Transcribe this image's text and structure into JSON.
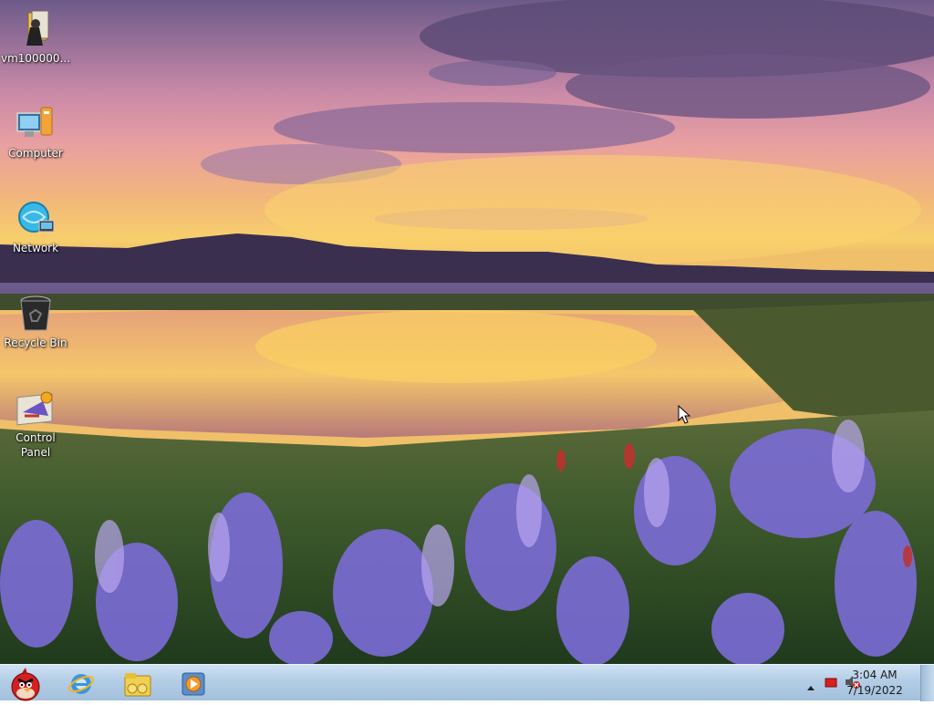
{
  "desktop": {
    "icons": [
      {
        "label": "vm100000...",
        "icon": "file-icon"
      },
      {
        "label": "Computer",
        "icon": "computer-icon"
      },
      {
        "label": "Network",
        "icon": "network-icon"
      },
      {
        "label": "Recycle Bin",
        "icon": "recycle-bin-icon"
      },
      {
        "label": "Control Panel",
        "icon": "control-panel-icon"
      }
    ]
  },
  "taskbar": {
    "pinned": [
      {
        "name": "angry-birds",
        "icon": "angry-birds-icon"
      },
      {
        "name": "internet-explorer",
        "icon": "ie-icon"
      },
      {
        "name": "windows-explorer",
        "icon": "folder-icon"
      },
      {
        "name": "media-player",
        "icon": "media-player-icon"
      }
    ],
    "tray": {
      "icons": [
        "show-hidden-icons-arrow",
        "action-center-flag-icon",
        "volume-muted-icon"
      ],
      "time": "3:04 AM",
      "date": "7/19/2022"
    }
  },
  "colors": {
    "taskbar": "#b3cde6",
    "label_text": "#ffffff"
  }
}
